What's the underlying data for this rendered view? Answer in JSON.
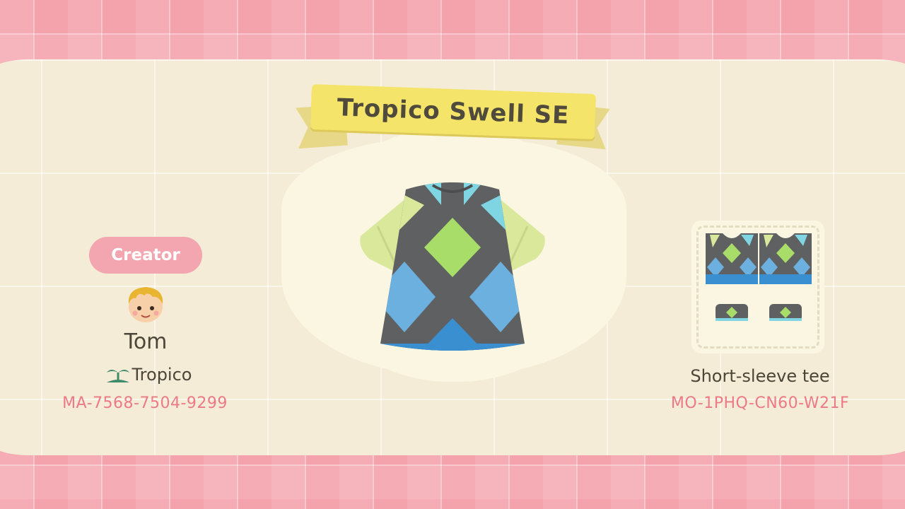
{
  "design": {
    "title": "Tropico Swell SE",
    "item_type": "Short-sleeve tee",
    "design_id": "MO-1PHQ-CN60-W21F"
  },
  "creator": {
    "label": "Creator",
    "name": "Tom",
    "island": "Tropico",
    "creator_id": "MA-7568-7504-9299"
  },
  "colors": {
    "pink_band": "#f4a3ad",
    "cream": "#f4ecd6",
    "ribbon": "#f4e56a",
    "id_text": "#ec7a86",
    "shirt_gray": "#5f6062",
    "diamond_green": "#a8dd6a",
    "diamond_blue": "#6cb0e0",
    "diamond_teal": "#7fd6e2",
    "diamond_pale": "#d9e89a"
  },
  "icons": {
    "island": "palm-tree-icon",
    "avatar": "villager-face-icon"
  }
}
